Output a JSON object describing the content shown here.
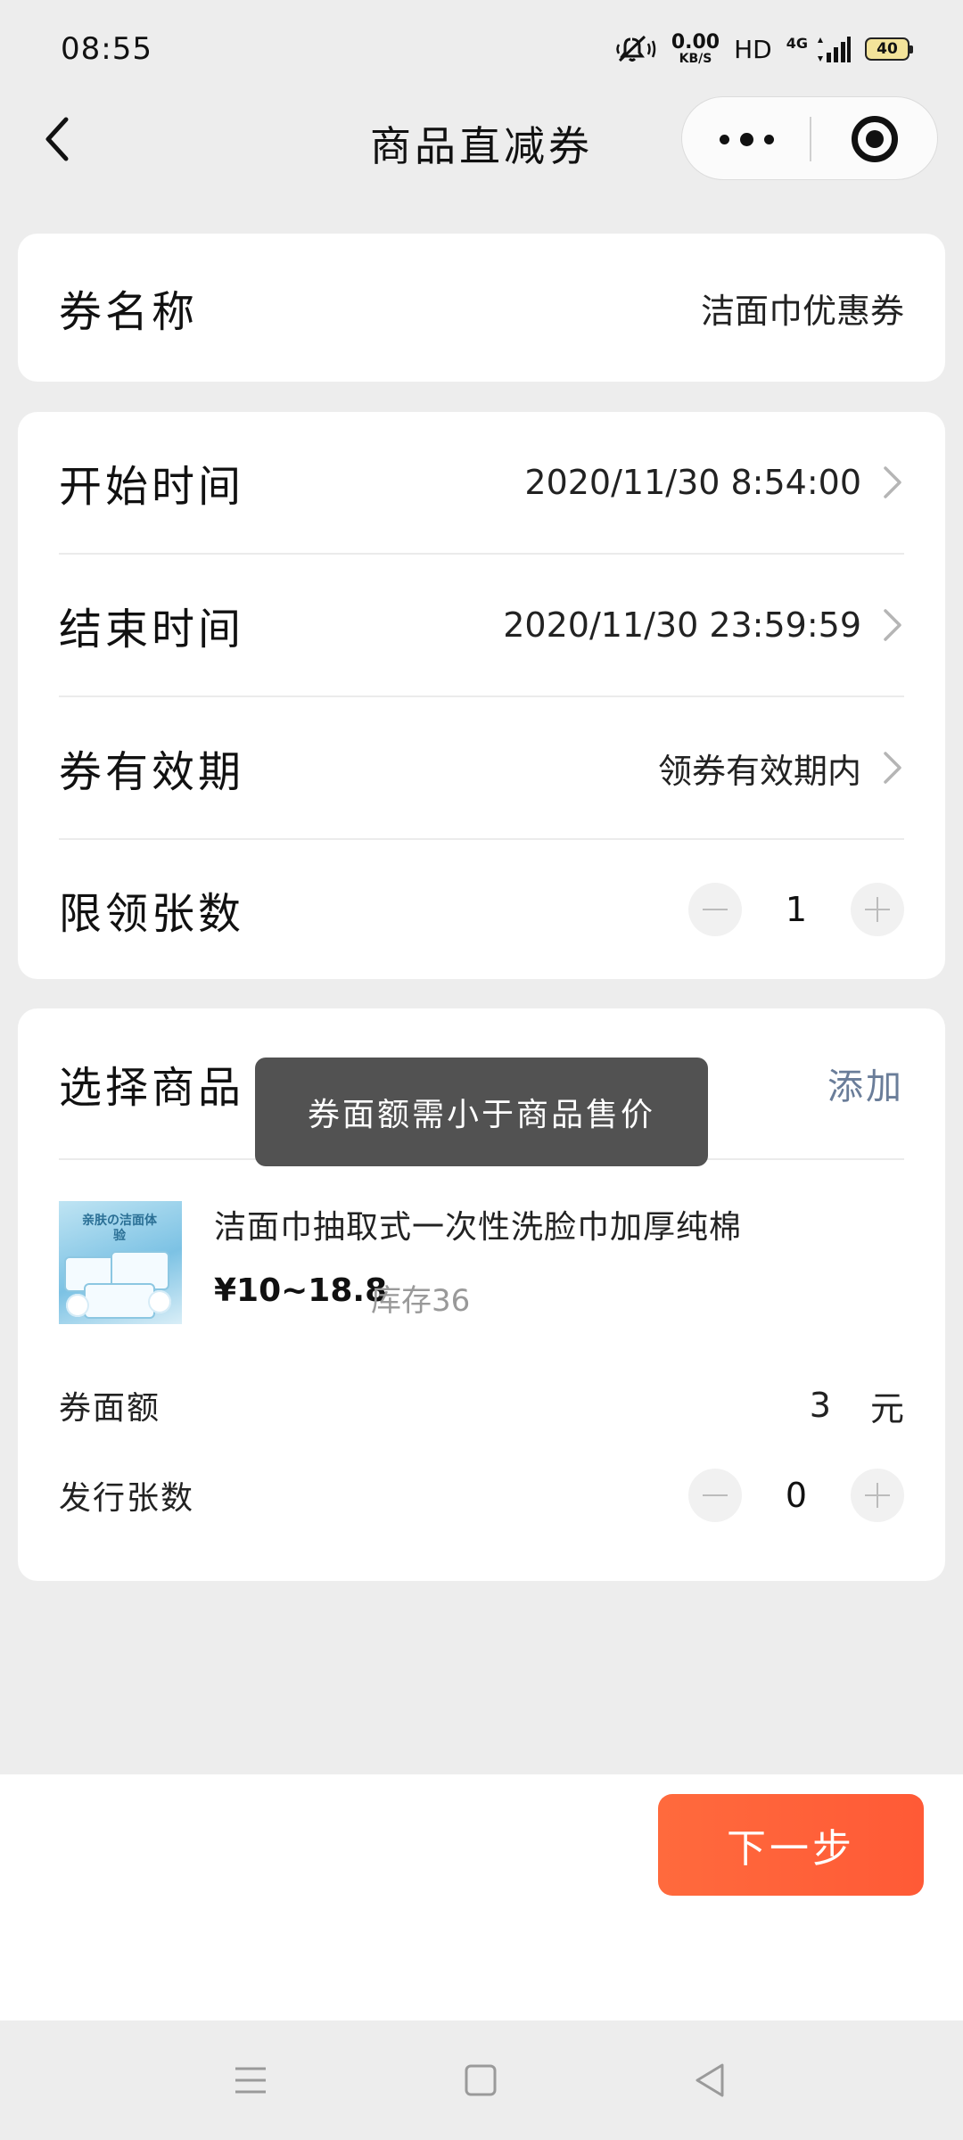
{
  "status_bar": {
    "time": "08:55",
    "net_speed_value": "0.00",
    "net_speed_unit": "KB/S",
    "hd": "HD",
    "network": "4G",
    "battery": "40",
    "icons": [
      "mute-icon",
      "signal-icon",
      "battery-icon"
    ]
  },
  "nav": {
    "title": "商品直减券",
    "back_icon": "chevron-left-icon",
    "more_icon": "more-dots-icon",
    "close_icon": "target-close-icon"
  },
  "coupon_name": {
    "label": "券名称",
    "value": "洁面巾优惠券"
  },
  "schedule": {
    "start": {
      "label": "开始时间",
      "value": "2020/11/30 8:54:00"
    },
    "end": {
      "label": "结束时间",
      "value": "2020/11/30 23:59:59"
    },
    "validity": {
      "label": "券有效期",
      "value": "领券有效期内"
    },
    "limit": {
      "label": "限领张数",
      "value": "1"
    }
  },
  "goods": {
    "label": "选择商品",
    "add": "添加",
    "item": {
      "title": "洁面巾抽取式一次性洗脸巾加厚纯棉",
      "price": "¥10~18.8",
      "stock": "库存36",
      "thumb_text": "亲肤の洁面体验"
    },
    "face_value": {
      "label": "券面额",
      "value": "3",
      "unit": "元"
    },
    "issue_count": {
      "label": "发行张数",
      "value": "0"
    }
  },
  "toast": "券面额需小于商品售价",
  "footer": {
    "next": "下一步"
  },
  "colors": {
    "accent": "#ff5f39",
    "link": "#6a7d99",
    "background": "#ededed",
    "toast_bg": "#4c4c4c"
  }
}
